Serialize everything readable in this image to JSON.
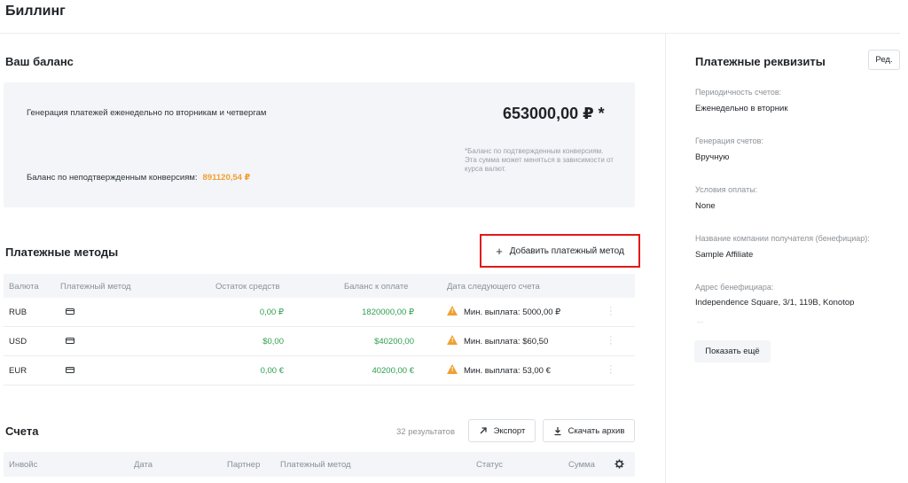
{
  "page_title": "Биллинг",
  "balance": {
    "title": "Ваш баланс",
    "generation_text": "Генерация платежей еженедельно по вторникам и четвергам",
    "amount": "653000,00 ₽ *",
    "note": "*Баланс по подтвержденным конверсиям. Эта сумма может меняться в зависимости от курса валют.",
    "unconfirmed_label": "Баланс по неподтвержденным конверсиям:",
    "unconfirmed_value": "891120,54 ₽"
  },
  "payment_methods": {
    "title": "Платежные методы",
    "add_button_icon": "+",
    "add_button_label": "Добавить платежный метод",
    "columns": [
      "Валюта",
      "Платежный метод",
      "Остаток средств",
      "Баланс к оплате",
      "Дата следующего счета"
    ],
    "rows": [
      {
        "currency": "RUB",
        "icon": "card-icon",
        "remaining": "0,00 ₽",
        "to_pay": "1820000,00 ₽",
        "next": "Мин. выплата: 5000,00 ₽"
      },
      {
        "currency": "USD",
        "icon": "card-icon",
        "remaining": "$0,00",
        "to_pay": "$40200,00",
        "next": "Мин. выплата: $60,50"
      },
      {
        "currency": "EUR",
        "icon": "card-icon",
        "remaining": "0,00 €",
        "to_pay": "40200,00 €",
        "next": "Мин. выплата: 53,00 €"
      }
    ]
  },
  "invoices": {
    "title": "Счета",
    "results": "32 результатов",
    "export_label": "Экспорт",
    "download_label": "Скачать архив",
    "columns": [
      "Инвойс",
      "Дата",
      "Партнер",
      "Платежный метод",
      "Статус",
      "Сумма"
    ]
  },
  "requisites": {
    "title": "Платежные реквизиты",
    "edit_label": "Ред.",
    "fields": [
      {
        "label": "Периодичность счетов:",
        "value": "Еженедельно в вторник"
      },
      {
        "label": "Генерация счетов:",
        "value": "Вручную"
      },
      {
        "label": "Условия оплаты:",
        "value": "None"
      },
      {
        "label": "Название компании получателя (бенефициар):",
        "value": "Sample Affiliate"
      },
      {
        "label": "Адрес бенефициара:",
        "value": "Independence Square, 3/1, 119B, Konotop"
      }
    ],
    "ellipsis": "...",
    "show_more_label": "Показать ещё"
  },
  "colors": {
    "accent_green": "#2e9e4f",
    "warning": "#f0a030",
    "highlight_red": "#e11a1a"
  }
}
